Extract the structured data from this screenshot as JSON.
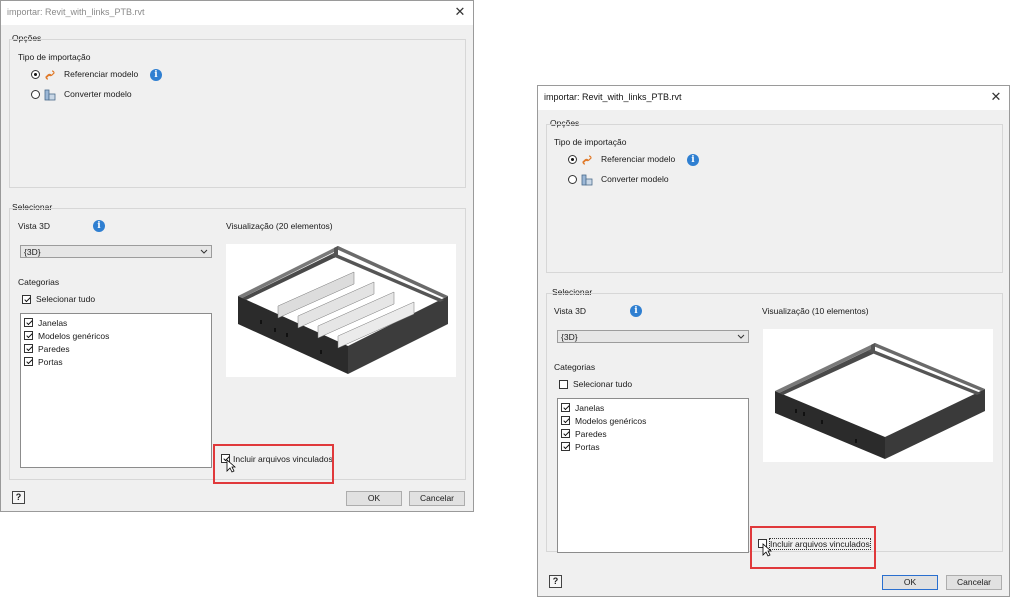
{
  "dialogs": [
    {
      "title": "importar: Revit_with_links_PTB.rvt",
      "options_group": "Opções",
      "import_type_label": "Tipo de importação",
      "radio_reference": "Referenciar modelo",
      "radio_convert": "Converter modelo",
      "reference_selected": true,
      "select_group": "Selecionar",
      "view3d_label": "Vista 3D",
      "view3d_value": "{3D}",
      "categories_label": "Categorias",
      "select_all": "Selecionar tudo",
      "select_all_checked": true,
      "categories": [
        "Janelas",
        "Modelos genéricos",
        "Paredes",
        "Portas"
      ],
      "preview_label": "Visualização (20 elementos)",
      "include_linked": "Incluir arquivos vinculados",
      "include_linked_checked": true,
      "ok": "OK",
      "cancel": "Cancelar",
      "help_icon": "?"
    },
    {
      "title": "importar: Revit_with_links_PTB.rvt",
      "options_group": "Opções",
      "import_type_label": "Tipo de importação",
      "radio_reference": "Referenciar modelo",
      "radio_convert": "Converter modelo",
      "reference_selected": true,
      "select_group": "Selecionar",
      "view3d_label": "Vista 3D",
      "view3d_value": "{3D}",
      "categories_label": "Categorias",
      "select_all": "Selecionar tudo",
      "select_all_checked": false,
      "categories": [
        "Janelas",
        "Modelos genéricos",
        "Paredes",
        "Portas"
      ],
      "preview_label": "Visualização (10 elementos)",
      "include_linked": "Incluir arquivos vinculados",
      "include_linked_checked": false,
      "ok": "OK",
      "cancel": "Cancelar",
      "help_icon": "?"
    }
  ],
  "colors": {
    "highlight": "#e0393b",
    "info": "#2f7fd1",
    "link_icon": "#e07a2a"
  },
  "icons": {
    "close": "close-icon",
    "info": "info-icon",
    "link": "link-icon",
    "convert": "convert-model-icon",
    "help": "help-icon",
    "cursor": "mouse-cursor-icon"
  }
}
